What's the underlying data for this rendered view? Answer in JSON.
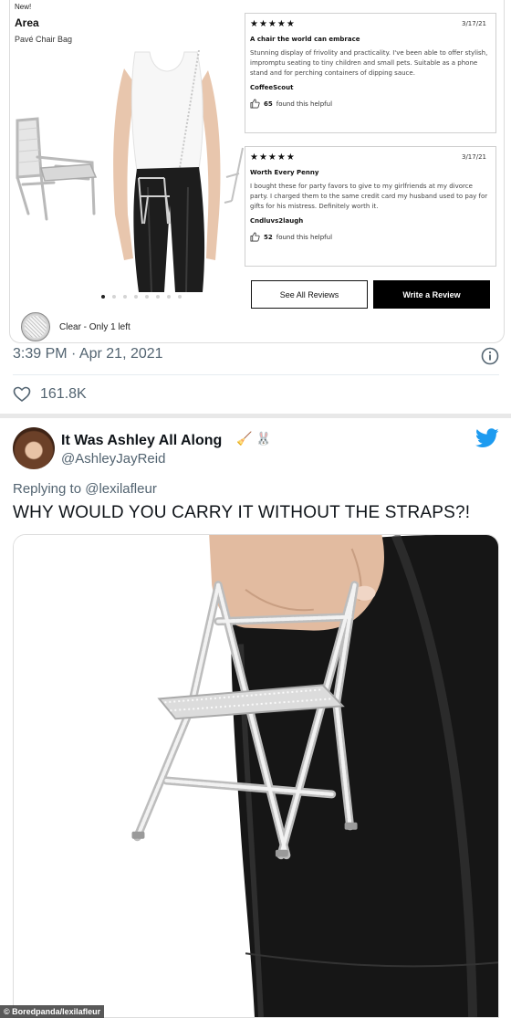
{
  "product": {
    "new_tag": "New!",
    "name": "Area",
    "subtitle": "Pavé Chair Bag",
    "color_label": "Clear - Only 1 left",
    "carousel_total": 8,
    "carousel_active": 1
  },
  "reviews": [
    {
      "stars": "★★★★★",
      "date": "3/17/21",
      "title": "A chair the world can embrace",
      "body": "Stunning display of frivolity and practicality. I've been able to offer stylish, impromptu  seating to tiny children and small pets. Suitable as a phone stand and for perching containers of dipping sauce.",
      "author": "CoffeeScout",
      "helpful_count": "65",
      "helpful_text": "found this helpful"
    },
    {
      "stars": "★★★★★",
      "date": "3/17/21",
      "title": "Worth Every Penny",
      "body": "I bought these for party favors to give to my girlfriends at my divorce party.  I charged them to the same credit card my husband used to pay for gifts for his mistress.  Definitely worth it.",
      "author": "Cndluvs2laugh",
      "helpful_count": "52",
      "helpful_text": "found this helpful"
    }
  ],
  "buttons": {
    "see_all": "See All Reviews",
    "write": "Write a Review"
  },
  "tweet1": {
    "timestamp": "3:39 PM · Apr 21, 2021",
    "likes": "161.8K"
  },
  "tweet2": {
    "display_name": "It Was Ashley All Along",
    "name_emojis": [
      "🧹",
      "🐰"
    ],
    "handle": "@AshleyJayReid",
    "replying_prefix": "Replying to",
    "replying_to": "@lexilafleur",
    "text": "WHY WOULD YOU CARRY IT WITHOUT THE STRAPS?!"
  },
  "watermark": "© Boredpanda/lexilafleur",
  "colors": {
    "twitter_blue": "#1d9bf0",
    "muted_text": "#536471",
    "black_button": "#000000"
  },
  "icons": [
    "info-icon",
    "heart-icon",
    "twitter-bird-icon",
    "thumbs-up-icon"
  ]
}
